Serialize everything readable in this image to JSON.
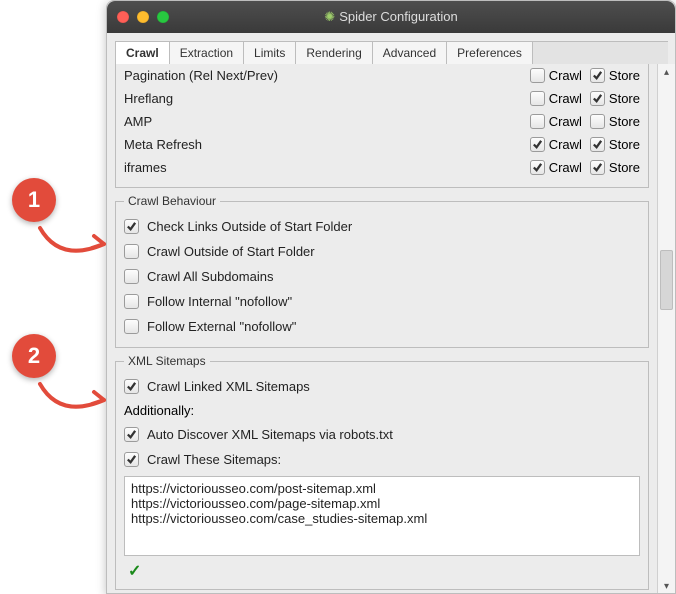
{
  "window": {
    "title": "Spider Configuration"
  },
  "tabs": [
    {
      "label": "Crawl",
      "active": true
    },
    {
      "label": "Extraction",
      "active": false
    },
    {
      "label": "Limits",
      "active": false
    },
    {
      "label": "Rendering",
      "active": false
    },
    {
      "label": "Advanced",
      "active": false
    },
    {
      "label": "Preferences",
      "active": false
    }
  ],
  "top_group_rows": [
    {
      "label": "Pagination (Rel Next/Prev)",
      "crawl_label": "Crawl",
      "crawl_checked": false,
      "store_label": "Store",
      "store_checked": true
    },
    {
      "label": "Hreflang",
      "crawl_label": "Crawl",
      "crawl_checked": false,
      "store_label": "Store",
      "store_checked": true
    },
    {
      "label": "AMP",
      "crawl_label": "Crawl",
      "crawl_checked": false,
      "store_label": "Store",
      "store_checked": false
    },
    {
      "label": "Meta Refresh",
      "crawl_label": "Crawl",
      "crawl_checked": true,
      "store_label": "Store",
      "store_checked": true
    },
    {
      "label": "iframes",
      "crawl_label": "Crawl",
      "crawl_checked": true,
      "store_label": "Store",
      "store_checked": true
    }
  ],
  "crawl_behaviour": {
    "legend": "Crawl Behaviour",
    "items": [
      {
        "label": "Check Links Outside of Start Folder",
        "checked": true
      },
      {
        "label": "Crawl Outside of Start Folder",
        "checked": false
      },
      {
        "label": "Crawl All Subdomains",
        "checked": false
      },
      {
        "label": "Follow Internal \"nofollow\"",
        "checked": false
      },
      {
        "label": "Follow External \"nofollow\"",
        "checked": false
      }
    ]
  },
  "xml_sitemaps": {
    "legend": "XML Sitemaps",
    "crawl_linked": {
      "label": "Crawl Linked XML Sitemaps",
      "checked": true
    },
    "additionally_label": "Additionally:",
    "auto_discover": {
      "label": "Auto Discover XML Sitemaps via robots.txt",
      "checked": true
    },
    "crawl_these": {
      "label": "Crawl These Sitemaps:",
      "checked": true
    },
    "sitemaps_text": "https://victoriousseo.com/post-sitemap.xml\nhttps://victoriousseo.com/page-sitemap.xml\nhttps://victoriousseo.com/case_studies-sitemap.xml",
    "validate_mark": "✓"
  },
  "annotations": {
    "b1": "1",
    "b2": "2"
  }
}
